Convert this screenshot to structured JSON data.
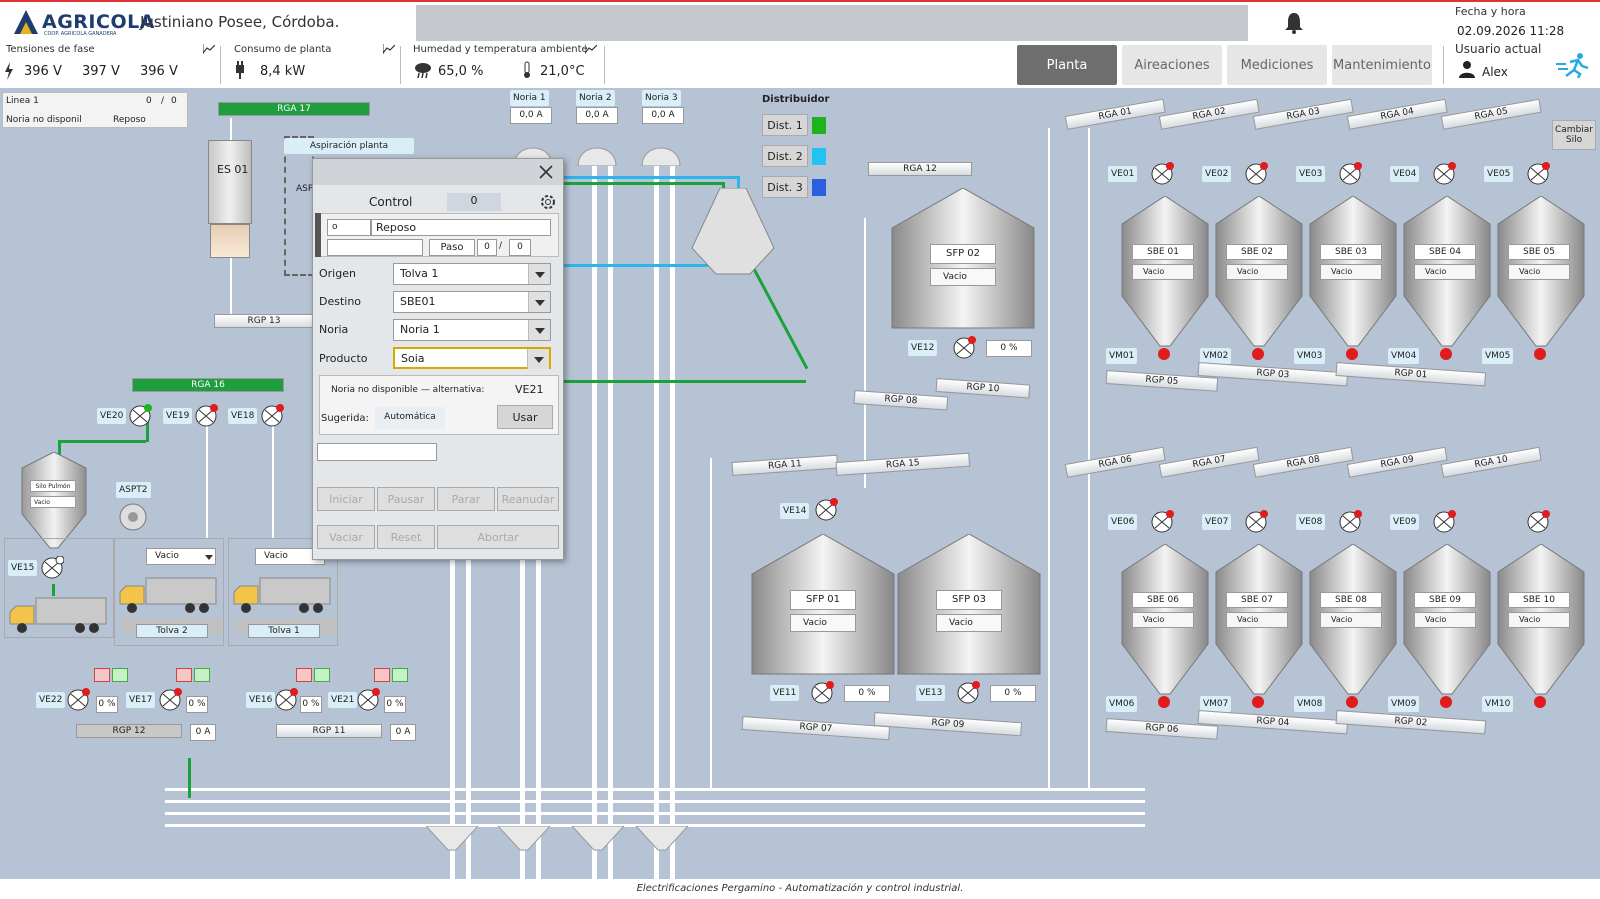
{
  "header": {
    "brand": "AGRICOLA",
    "brand_sub": "COOP. AGRICOLA GANADERA",
    "site": "Justiniano Posee, Córdoba.",
    "datetime_label": "Fecha y hora",
    "datetime_value": "02.09.2026 11:28"
  },
  "metrics": {
    "tension_label": "Tensiones de fase",
    "v1": "396 V",
    "v2": "397 V",
    "v3": "396 V",
    "consumo_label": "Consumo de planta",
    "consumo": "8,4 kW",
    "hum_label": "Humedad y temperatura ambiente",
    "humidity": "65,0 %",
    "temperature": "21,0°C"
  },
  "tabs": [
    "Planta",
    "Aireaciones",
    "Mediciones",
    "Mantenimiento"
  ],
  "user": {
    "label": "Usuario actual",
    "name": "Alex"
  },
  "linea": {
    "name": "Linea 1",
    "count": "0",
    "total": "0",
    "status": "Noria no disponil",
    "state": "Reposo"
  },
  "norias": [
    {
      "name": "Noria 1",
      "value": "0,0 A"
    },
    {
      "name": "Noria 2",
      "value": "0,0 A"
    },
    {
      "name": "Noria 3",
      "value": "0,0 A"
    }
  ],
  "distribuidor": {
    "title": "Distribuidor",
    "items": [
      {
        "label": "Dist. 1",
        "color": "#1db31d"
      },
      {
        "label": "Dist. 2",
        "color": "#22c3f0"
      },
      {
        "label": "Dist. 3",
        "color": "#2a5fe0"
      }
    ]
  },
  "cambiar": "Cambiar Silo",
  "left": {
    "rga17": "RGA 17",
    "es01": "ES 01",
    "aspiracion": "Aspiración planta",
    "asp": "ASP",
    "rgp13": "RGP 13",
    "rga16": "RGA 16",
    "ve20": "VE20",
    "ve19": "VE19",
    "ve18": "VE18",
    "silo_pulmon": "Silo Pulmón",
    "silo_pulmon_state": "Vacio",
    "aspt2": "ASPT2",
    "ve15": "VE15",
    "tolva2_state": "Vacio",
    "tolva1_state": "Vacio",
    "tolva2": "Tolva 2",
    "tolva1": "Tolva 1",
    "ve22": "VE22",
    "ve17": "VE17",
    "ve16": "VE16",
    "ve21": "VE21",
    "pct": "0 %",
    "rgp12": "RGP 12",
    "rgp11": "RGP 11",
    "amp": "0 A"
  },
  "dialog": {
    "title": "Control",
    "title_value": "0",
    "sub_indicator": "o",
    "state": "Reposo",
    "paso_label": "Paso",
    "paso": "0",
    "paso_total": "0",
    "origen_label": "Origen",
    "origen": "Tolva 1",
    "destino_label": "Destino",
    "destino": "SBE01",
    "noria_label": "Noria",
    "noria": "Noria 1",
    "producto_label": "Producto",
    "producto": "Soia",
    "alt_msg": "Noria no disponible — alternativa:",
    "alt_value": "VE21",
    "sugerida_label": "Sugerida:",
    "sugerida_value": "Automática",
    "usar": "Usar",
    "iniciar": "Iniciar",
    "pausar": "Pausar",
    "parar": "Parar",
    "reanudar": "Reanudar",
    "vaciar": "Vaciar",
    "reset": "Reset",
    "abortar": "Abortar"
  },
  "center": {
    "rga12": "RGA 12",
    "sfp02": "SFP 02",
    "sfp02_state": "Vacio",
    "ve12": "VE12",
    "ve12_pct": "0 %",
    "rgp08": "RGP 08",
    "rgp10": "RGP 10",
    "rga11": "RGA 11",
    "rga15": "RGA 15",
    "ve14": "VE14",
    "sfp01": "SFP 01",
    "sfp01_state": "Vacio",
    "sfp03": "SFP 03",
    "sfp03_state": "Vacio",
    "ve11": "VE11",
    "ve11_pct": "0 %",
    "ve13": "VE13",
    "ve13_pct": "0 %",
    "rgp07": "RGP 07",
    "rgp09": "RGP 09"
  },
  "top_bins": {
    "rga": [
      "RGA 01",
      "RGA 02",
      "RGA 03",
      "RGA 04",
      "RGA 05"
    ],
    "ve": [
      "VE01",
      "VE02",
      "VE03",
      "VE04",
      "VE05"
    ],
    "sbe": [
      "SBE 01",
      "SBE 02",
      "SBE 03",
      "SBE 04",
      "SBE 05"
    ],
    "state": "Vacio",
    "vm": [
      "VM01",
      "VM02",
      "VM03",
      "VM04",
      "VM05"
    ],
    "rgp": [
      "RGP 05",
      "RGP 03",
      "RGP 01"
    ]
  },
  "bot_bins": {
    "rga": [
      "RGA 06",
      "RGA 07",
      "RGA 08",
      "RGA 09",
      "RGA 10"
    ],
    "ve": [
      "VE06",
      "VE07",
      "VE08",
      "VE09"
    ],
    "sbe": [
      "SBE 06",
      "SBE 07",
      "SBE 08",
      "SBE 09",
      "SBE 10"
    ],
    "state": "Vacio",
    "vm": [
      "VM06",
      "VM07",
      "VM08",
      "VM09",
      "VM10"
    ],
    "rgp": [
      "RGP 06",
      "RGP 04",
      "RGP 02"
    ]
  },
  "footer": "Electrificaciones Pergamino - Automatización y control industrial."
}
